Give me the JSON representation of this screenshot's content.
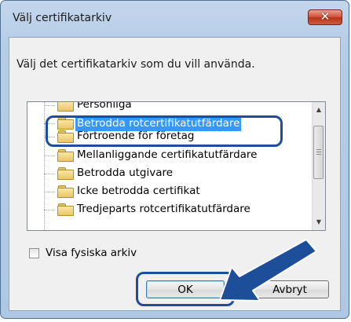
{
  "window": {
    "title": "Välj certifikatarkiv",
    "close_glyph": "✕"
  },
  "instruction": "Välj det certifikatarkiv som du vill använda.",
  "tree": {
    "items": [
      {
        "label": "Personliga"
      },
      {
        "label": "Betrodda rotcertifikatutfärdare",
        "selected": true
      },
      {
        "label": "Förtroende för företag"
      },
      {
        "label": "Mellanliggande certifikatutfärdare"
      },
      {
        "label": "Betrodda utgivare"
      },
      {
        "label": "Icke betrodda certifikat"
      },
      {
        "label": "Tredjeparts rotcertifikatutfärdare"
      }
    ],
    "scroll_up": "▲",
    "scroll_down": "▼"
  },
  "checkbox": {
    "label": "Visa fysiska arkiv",
    "checked": false
  },
  "buttons": {
    "ok": "OK",
    "cancel": "Avbryt"
  },
  "colors": {
    "selection": "#3399ff",
    "callout": "#1d4e9a"
  }
}
